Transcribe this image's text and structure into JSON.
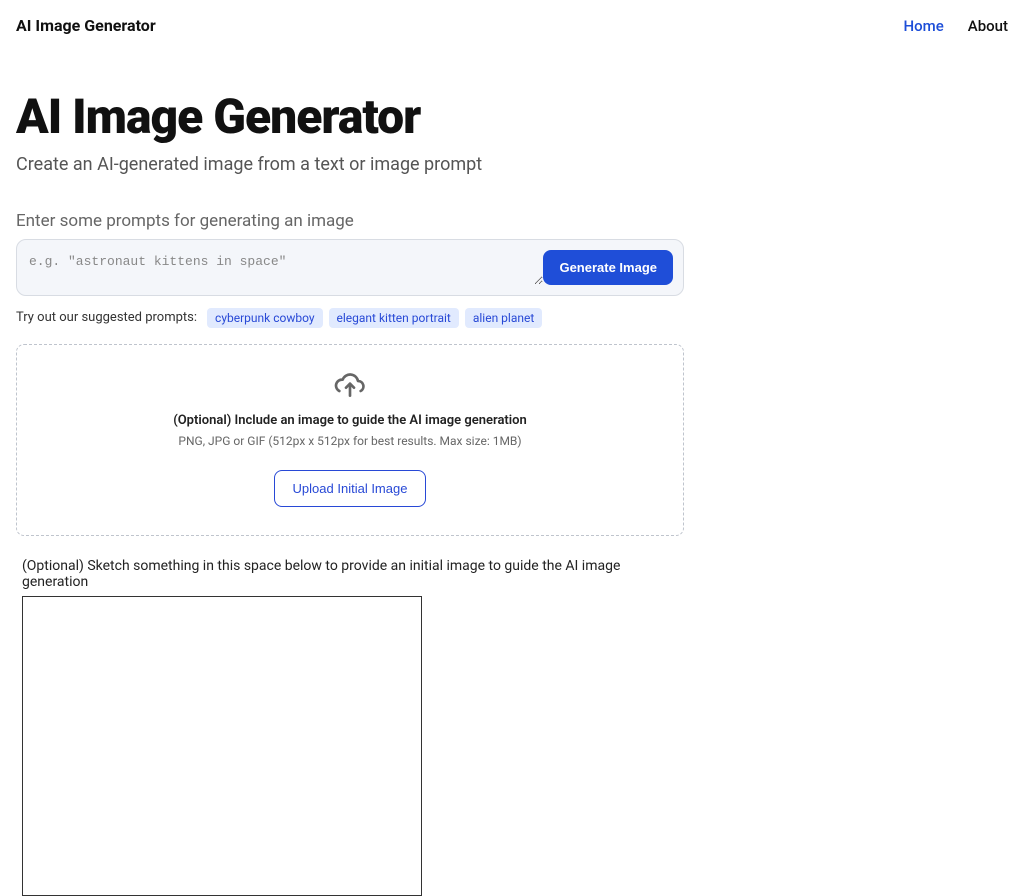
{
  "nav": {
    "brand": "AI Image Generator",
    "home": "Home",
    "about": "About"
  },
  "hero": {
    "title": "AI Image Generator",
    "subtitle": "Create an AI-generated image from a text or image prompt"
  },
  "prompt": {
    "label": "Enter some prompts for generating an image",
    "placeholder": "e.g. \"astronaut kittens in space\"",
    "button": "Generate Image"
  },
  "suggested": {
    "label": "Try out our suggested prompts:",
    "chips": [
      "cyberpunk cowboy",
      "elegant kitten portrait",
      "alien planet"
    ]
  },
  "upload": {
    "title": "(Optional) Include an image to guide the AI image generation",
    "sub": "PNG, JPG or GIF (512px x 512px for best results. Max size: 1MB)",
    "button": "Upload Initial Image"
  },
  "sketch": {
    "label": "(Optional) Sketch something in this space below to provide an initial image to guide the AI image generation"
  },
  "colors": {
    "accent": "#1f4ed8",
    "chip_bg": "#e1eafe",
    "chip_text": "#2849d6"
  }
}
